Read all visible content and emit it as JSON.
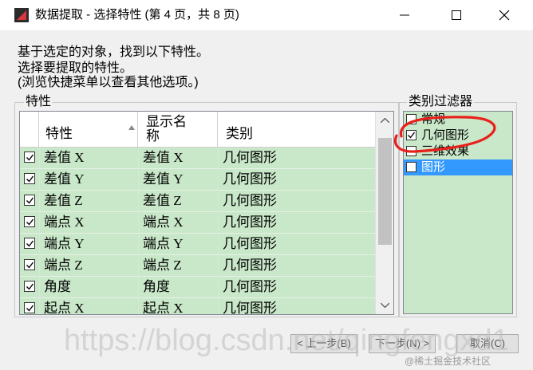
{
  "window": {
    "title": "数据提取 - 选择特性 (第 4 页，共 8 页)",
    "minimize_icon": "minimize-icon",
    "maximize_icon": "maximize-icon",
    "close_icon": "close-icon"
  },
  "intro": {
    "line1": "基于选定的对象，找到以下特性。",
    "line2": "选择要提取的特性。",
    "line3": "(浏览快捷菜单以查看其他选项。)"
  },
  "properties_group": {
    "label": "特性",
    "columns": [
      "特性",
      "显示名称",
      "类别"
    ],
    "display_name_header_lines": [
      "显示名",
      "称"
    ],
    "rows": [
      {
        "checked": true,
        "property": "差值 X",
        "display": "差值 X",
        "category": "几何图形"
      },
      {
        "checked": true,
        "property": "差值 Y",
        "display": "差值 Y",
        "category": "几何图形"
      },
      {
        "checked": true,
        "property": "差值 Z",
        "display": "差值 Z",
        "category": "几何图形"
      },
      {
        "checked": true,
        "property": "端点 X",
        "display": "端点 X",
        "category": "几何图形"
      },
      {
        "checked": true,
        "property": "端点 Y",
        "display": "端点 Y",
        "category": "几何图形"
      },
      {
        "checked": true,
        "property": "端点 Z",
        "display": "端点 Z",
        "category": "几何图形"
      },
      {
        "checked": true,
        "property": "角度",
        "display": "角度",
        "category": "几何图形"
      },
      {
        "checked": true,
        "property": "起点 X",
        "display": "起点 X",
        "category": "几何图形"
      }
    ]
  },
  "filter_group": {
    "label": "类别过滤器",
    "items": [
      {
        "label": "常规",
        "checked": false,
        "selected": false
      },
      {
        "label": "几何图形",
        "checked": true,
        "selected": false
      },
      {
        "label": "三维效果",
        "checked": false,
        "selected": false
      },
      {
        "label": "图形",
        "checked": false,
        "selected": true
      }
    ]
  },
  "buttons": {
    "back": "< 上一步(B)",
    "next": "下一步(N) >",
    "cancel": "取消(C)"
  },
  "watermark": {
    "url": "https://blog.csdn.net/qingfengxd1",
    "credit": "@稀土掘金技术社区"
  },
  "colors": {
    "row_bg": "#c9e7c9",
    "selection": "#3399ff",
    "annotation_red": "#e8201a"
  }
}
